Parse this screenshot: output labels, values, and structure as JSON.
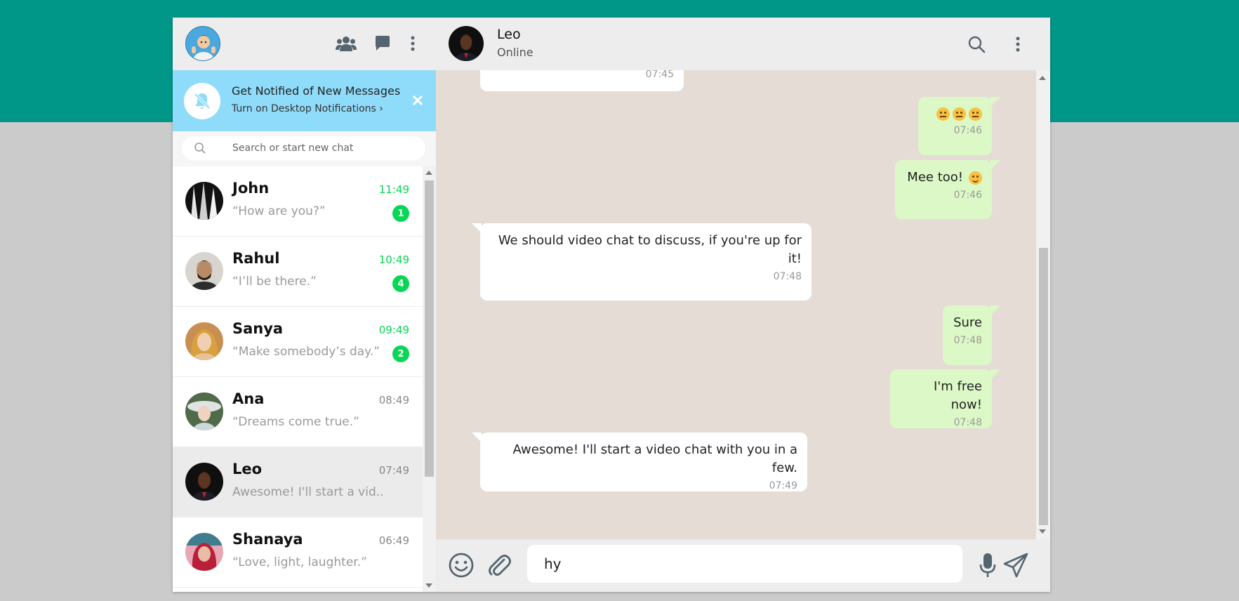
{
  "colors": {
    "teal": "#009688",
    "green_accent": "#06d755",
    "notif_bg": "#8fdcfa",
    "outgoing_bubble": "#dcf8c6",
    "chat_bg": "#e5ddd5"
  },
  "sidebar": {
    "header": {
      "icons": [
        "people-icon",
        "chat-icon",
        "more-vertical-icon"
      ]
    },
    "notification": {
      "title": "Get Notified of New Messages",
      "subtitle": "Turn on Desktop Notifications ›"
    },
    "search": {
      "placeholder": "Search or start new chat"
    },
    "chats": [
      {
        "name": "John",
        "time": "11:49",
        "preview": "“How are you?”",
        "unread": "1"
      },
      {
        "name": "Rahul",
        "time": "10:49",
        "preview": "“I’ll be there.”",
        "unread": "4"
      },
      {
        "name": "Sanya",
        "time": "09:49",
        "preview": "“Make somebody’s day.”",
        "unread": "2"
      },
      {
        "name": "Ana",
        "time": "08:49",
        "preview": "“Dreams come true.”",
        "unread": ""
      },
      {
        "name": "Leo",
        "time": "07:49",
        "preview": "Awesome! I'll start a vid..",
        "unread": ""
      },
      {
        "name": "Shanaya",
        "time": "06:49",
        "preview": "“Love, light, laughter.”",
        "unread": ""
      }
    ]
  },
  "conversation": {
    "contact": {
      "name": "Leo",
      "status": "Online"
    },
    "messages": [
      {
        "dir": "in",
        "text": "",
        "time": "07:45"
      },
      {
        "dir": "out",
        "text": "",
        "time": "07:46"
      },
      {
        "dir": "out",
        "text": "Mee too!",
        "time": "07:46"
      },
      {
        "dir": "in",
        "text": "We should video chat to discuss, if you're up for it!",
        "time": "07:48"
      },
      {
        "dir": "out",
        "text": "Sure",
        "time": "07:48"
      },
      {
        "dir": "out",
        "text": "I'm free now!",
        "time": "07:48"
      },
      {
        "dir": "in",
        "text": "Awesome! I'll start a video chat with you in a few.",
        "time": "07:49"
      }
    ],
    "composer": {
      "value": "hy"
    }
  }
}
